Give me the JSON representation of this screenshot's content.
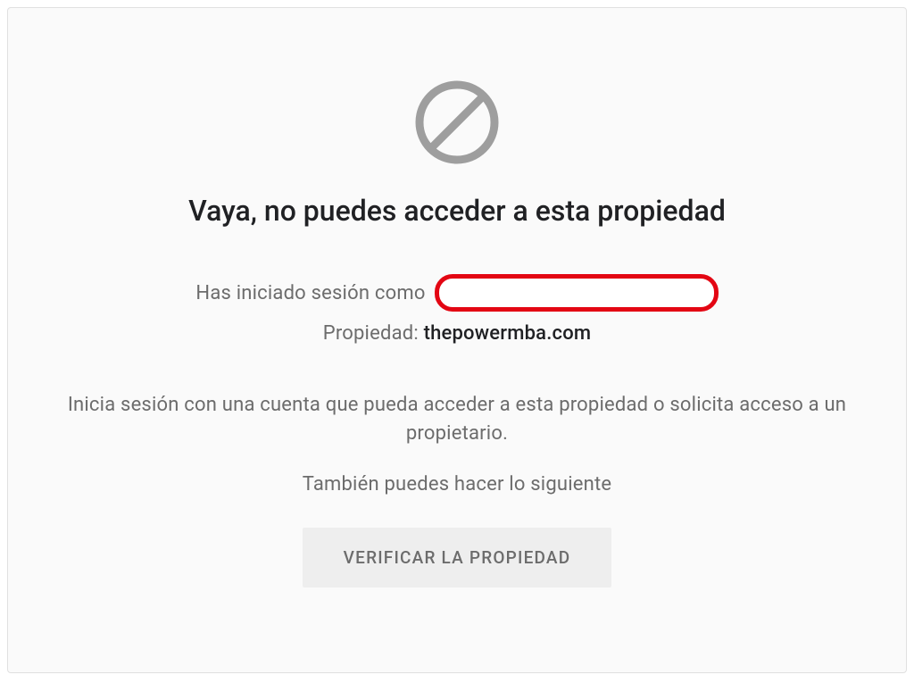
{
  "icon": {
    "name": "prohibit-icon",
    "stroke_color": "#9e9e9e"
  },
  "title": "Vaya, no puedes acceder a esta propiedad",
  "session": {
    "label": "Has iniciado sesión como",
    "user_redacted": true
  },
  "property": {
    "label": "Propiedad:",
    "value": "thepowermba.com"
  },
  "instruction": "Inicia sesión con una cuenta que pueda acceder a esta propiedad o solicita acceso a un propietario.",
  "also_text": "También puedes hacer lo siguiente",
  "verify_button_label": "VERIFICAR LA PROPIEDAD",
  "annotation": {
    "highlight_color": "#e30613"
  }
}
